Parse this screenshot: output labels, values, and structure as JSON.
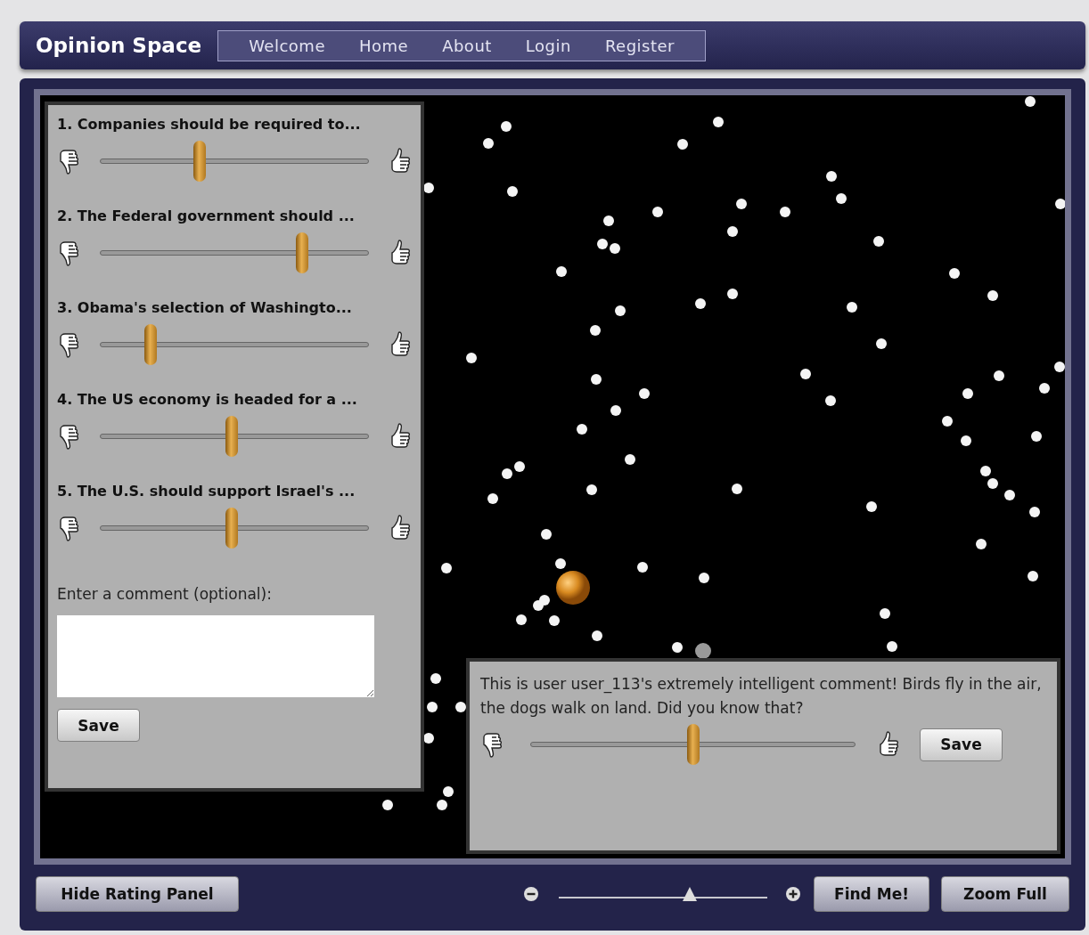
{
  "header": {
    "title": "Opinion Space",
    "nav": [
      {
        "label": "Welcome"
      },
      {
        "label": "Home"
      },
      {
        "label": "About"
      },
      {
        "label": "Login"
      },
      {
        "label": "Register"
      }
    ]
  },
  "rating_panel": {
    "questions": [
      {
        "text": "1. Companies should be required to...",
        "level": 0.37
      },
      {
        "text": "2. The Federal government should ...",
        "level": 0.75
      },
      {
        "text": "3. Obama's selection of Washingto...",
        "level": 0.19
      },
      {
        "text": "4. The US economy is headed for a ...",
        "level": 0.49
      },
      {
        "text": "5. The U.S. should support Israel's ...",
        "level": 0.49
      }
    ],
    "comment_label": "Enter a comment (optional):",
    "save_button": "Save"
  },
  "comment_panel": {
    "text": "This is user user_113's extremely intelligent comment! Birds fly in the air, the dogs walk on land. Did you know that?",
    "level": 0.5,
    "save_button": "Save"
  },
  "bottom_bar": {
    "hide_button": "Hide Rating Panel",
    "zoom": {
      "level": 0.63
    },
    "find_button": "Find Me!",
    "zoom_full_button": "Zoom Full"
  }
}
